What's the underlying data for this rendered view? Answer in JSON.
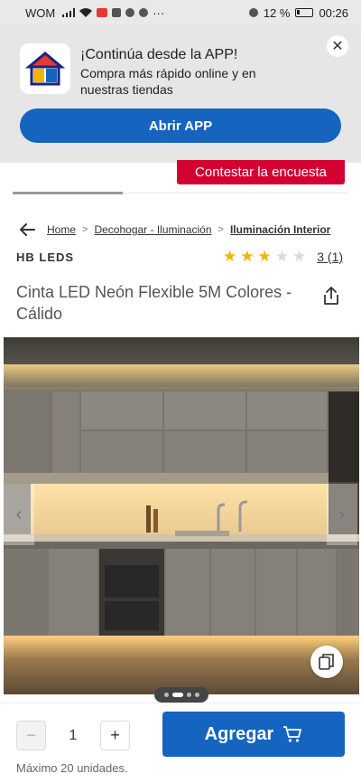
{
  "status_bar": {
    "carrier": "WOM",
    "battery": "12 %",
    "time": "00:26"
  },
  "app_banner": {
    "title": "¡Continúa desde la APP!",
    "subtitle": "Compra más rápido online y en nuestras tiendas",
    "button_label": "Abrir APP",
    "close_icon": "close-icon",
    "button_color": "#1565c0"
  },
  "survey": {
    "label": "Contestar la encuesta",
    "color": "#d50032"
  },
  "breadcrumb": {
    "items": [
      "Home",
      "Decohogar - Iluminación",
      "Iluminación Interior"
    ],
    "separator": ">"
  },
  "product": {
    "brand": "HB LEDS",
    "rating": 3,
    "rating_max": 5,
    "rating_count": "3 (1)",
    "title": "Cinta LED Neón Flexible 5M Colores - Cálido",
    "image_count": 4,
    "active_image": 2
  },
  "purchase": {
    "quantity": "1",
    "minus": "−",
    "plus": "+",
    "add_label": "Agregar",
    "max_label": "Máximo 20 unidades."
  },
  "colors": {
    "accent": "#1565c0",
    "star": "#f5b301"
  }
}
